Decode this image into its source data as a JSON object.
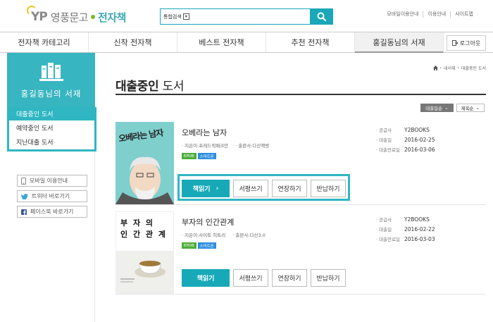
{
  "header": {
    "logo_yp": "YP",
    "logo_name": "영풍문고",
    "logo_ebook": "전자책",
    "search_scope": "통합검색",
    "search_placeholder": "",
    "util_links": [
      "모바일이용안내",
      "이용안내",
      "사이트맵"
    ]
  },
  "nav": {
    "items": [
      "전자책 카테고리",
      "신착 전자책",
      "베스트 전자책",
      "추천 전자책",
      "홍길동님의 서재"
    ],
    "login": "로그아웃"
  },
  "sidebar": {
    "title": "홍길동님의 서재",
    "menu": [
      "대출중인 도서",
      "예약중인 도서",
      "지난대출 도서"
    ],
    "links": [
      "모바일 이용안내",
      "트위터 바로가기",
      "페이스북 바로가기"
    ]
  },
  "content": {
    "breadcrumb": [
      "내서재",
      "대출중인 도서"
    ],
    "title_bold": "대출중인",
    "title_rest": " 도서",
    "sort": [
      "대출일순",
      "제목순"
    ],
    "info_labels": [
      "공급사",
      "대출일",
      "대출만료일"
    ],
    "buttons": {
      "read": "책읽기",
      "review": "서평쓰기",
      "extend": "연장하기",
      "return": "반납하기"
    },
    "books": [
      {
        "title": "오베라는 남자",
        "author": "지은이:프레드릭배크만",
        "publisher": "출판사:다산책방",
        "badges": [
          "EPUB",
          "스마트폰"
        ],
        "supplier": "Y2BOOKS",
        "loan_date": "2016-02-25",
        "due_date": "2016-03-06",
        "cover_text": "오베라는 남자"
      },
      {
        "title": "부자의 인간관계",
        "author": "지은이:사이토 히토리",
        "publisher": "출판사:다산3.0",
        "badges": [
          "EPUB",
          "스마트폰"
        ],
        "supplier": "Y2BOOKS",
        "loan_date": "2016-02-22",
        "due_date": "2016-03-03",
        "cover_line1": "부 자 의",
        "cover_line2": "인 간 관 계"
      }
    ]
  },
  "colors": {
    "accent": "#1aa7b8",
    "sidebar_head": "#37b5c0",
    "badge_epub": "#4cae3a",
    "badge_phone": "#2c8ee0"
  }
}
